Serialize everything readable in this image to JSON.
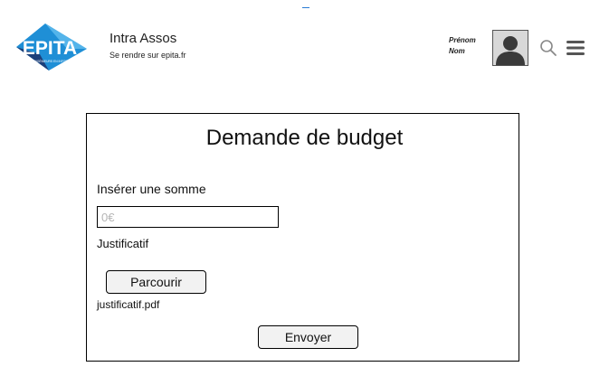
{
  "header": {
    "logo_text": "EPITA",
    "logo_tagline": "ÉCOLE D'INGÉNIEURS EN INFORMATIQUE",
    "app_title": "Intra Assos",
    "app_subtitle": "Se rendre sur epita.fr",
    "user": {
      "first_name": "Prénom",
      "last_name": "Nom"
    },
    "icons": {
      "avatar": "user-silhouette",
      "search": "search-icon",
      "menu": "hamburger-menu-icon"
    }
  },
  "form": {
    "title": "Demande de budget",
    "amount_label": "Insérer une somme",
    "amount_placeholder": "0€",
    "amount_value": "",
    "attachment_label": "Justificatif",
    "browse_button": "Parcourir",
    "file_name": "justificatif.pdf",
    "submit_button": "Envoyer"
  },
  "colors": {
    "logo_blue": "#1f8fd6",
    "logo_dark": "#1b3f7a",
    "button_bg": "#f2f2f2",
    "border": "#000000",
    "placeholder": "#b5b5b5"
  }
}
